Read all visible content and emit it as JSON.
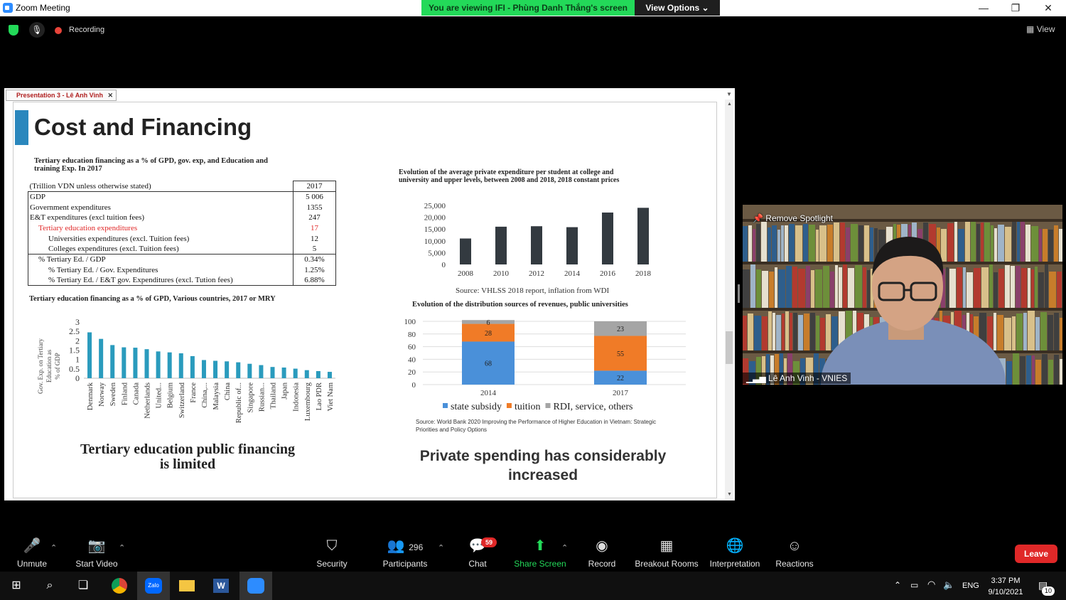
{
  "window": {
    "title": "Zoom Meeting",
    "viewing_banner": "You are viewing IFI - Phùng Danh Thắng's screen",
    "view_options": "View Options",
    "recording": "Recording",
    "view": "View"
  },
  "share": {
    "tab_title": "Presentation 3 - Lê Anh Vinh"
  },
  "slide": {
    "title": "Cost and Financing",
    "table_title_1": "Tertiary education financing as a % of GPD, gov. exp, and Education and",
    "table_title_2": "training Exp. In 2017",
    "table": {
      "header_label": "(Trillion VDN unless otherwise stated)",
      "header_year": "2017",
      "rows": [
        {
          "label": "GDP",
          "value": "5 006"
        },
        {
          "label": "Government expenditures",
          "value": "1355"
        },
        {
          "label": "E&T expenditures (excl tuition fees)",
          "value": "247"
        },
        {
          "label": "Tertiary education expenditures",
          "value": "17"
        },
        {
          "label": "Universities expenditures (excl. Tuition fees)",
          "value": "12"
        },
        {
          "label": "Colleges expenditures (excl. Tuition fees)",
          "value": "5"
        },
        {
          "label": "% Tertiary Ed. / GDP",
          "value": "0.34%"
        },
        {
          "label": "% Tertiary Ed. / Gov. Expenditures",
          "value": "1.25%"
        },
        {
          "label": "% Tertiary Ed. / E&T gov. Expenditures (excl. Tution fees)",
          "value": "6.88%"
        }
      ]
    },
    "countries_title": "Tertiary education financing as a % of GPD, Various countries, 2017 or MRY",
    "left_caption_1": "Tertiary education public financing",
    "left_caption_2": "is limited",
    "private_title_1": "Evolution of the average private expenditure per student at college and",
    "private_title_2": "university and upper levels, between 2008 and 2018, 2018 constant prices",
    "private_source": "Source: VHLSS 2018 report, inflation from WDI",
    "revenue_title": "Evolution of the distribution sources of revenues, public universities",
    "revenue_source_1": "Source: World Bank 2020 Improving the Performance of Higher Education in Vietnam: Strategic",
    "revenue_source_2": "Priorities and Policy Options",
    "right_caption_1": "Private spending has considerably",
    "right_caption_2": "increased"
  },
  "chart_data": [
    {
      "type": "bar",
      "title": "Tertiary education financing as a % of GPD, Various countries, 2017 or MRY",
      "ylabel_lines": [
        "Gov. Exp. on Tertiary",
        "Education as",
        "% of GDP"
      ],
      "ylim": [
        0,
        3
      ],
      "yticks": [
        "3",
        "2.5",
        "2",
        "1.5",
        "1",
        "0.5",
        "0"
      ],
      "categories": [
        "Denmark",
        "Norway",
        "Sweden",
        "Finland",
        "Canada",
        "Netherlands",
        "United...",
        "Belgium",
        "Switzerland",
        "France",
        "China,...",
        "Malaysia",
        "China",
        "Republic of...",
        "Singapore",
        "Russian...",
        "Thailand",
        "Japan",
        "Indonesia",
        "Luxembourg",
        "Lao PDR",
        "Viet Nam"
      ],
      "values": [
        2.45,
        2.1,
        1.77,
        1.65,
        1.63,
        1.55,
        1.43,
        1.38,
        1.33,
        1.18,
        0.97,
        0.93,
        0.9,
        0.85,
        0.77,
        0.7,
        0.6,
        0.57,
        0.51,
        0.43,
        0.38,
        0.34
      ],
      "color": "#2a9bbd"
    },
    {
      "type": "bar",
      "title": "Evolution of the average private expenditure per student at college and university and upper levels, between 2008 and 2018, 2018 constant prices",
      "categories": [
        "2008",
        "2010",
        "2012",
        "2014",
        "2016",
        "2018"
      ],
      "values": [
        11000,
        16000,
        16200,
        15800,
        22000,
        24000
      ],
      "ylim": [
        0,
        25000
      ],
      "yticks": [
        "25,000",
        "20,000",
        "15,000",
        "10,000",
        "5,000",
        "0"
      ],
      "color": "#333a40"
    },
    {
      "type": "bar",
      "stacked": true,
      "title": "Evolution of the distribution sources of revenues, public universities",
      "categories": [
        "2014",
        "2017"
      ],
      "ylim": [
        0,
        100
      ],
      "yticks": [
        "100",
        "80",
        "60",
        "40",
        "20",
        "0"
      ],
      "series": [
        {
          "name": "state subsidy",
          "values": [
            68,
            22
          ],
          "color": "#4a90d9"
        },
        {
          "name": "tuition",
          "values": [
            28,
            55
          ],
          "color": "#f07b27"
        },
        {
          "name": "RDI, service, others",
          "values": [
            6,
            23
          ],
          "color": "#a5a5a5"
        }
      ]
    }
  ],
  "video": {
    "remove_spotlight": "Remove Spotlight",
    "name": "Lê Anh Vinh - VNIES"
  },
  "toolbar": {
    "unmute": "Unmute",
    "start_video": "Start Video",
    "security": "Security",
    "participants": "Participants",
    "participants_count": "296",
    "chat": "Chat",
    "chat_badge": "59",
    "share_screen": "Share Screen",
    "record": "Record",
    "breakout": "Breakout Rooms",
    "interpretation": "Interpretation",
    "reactions": "Reactions",
    "leave": "Leave"
  },
  "taskbar": {
    "time": "3:37 PM",
    "date": "9/10/2021",
    "lang": "ENG",
    "notif_count": "10",
    "zalo": "Zalo"
  }
}
